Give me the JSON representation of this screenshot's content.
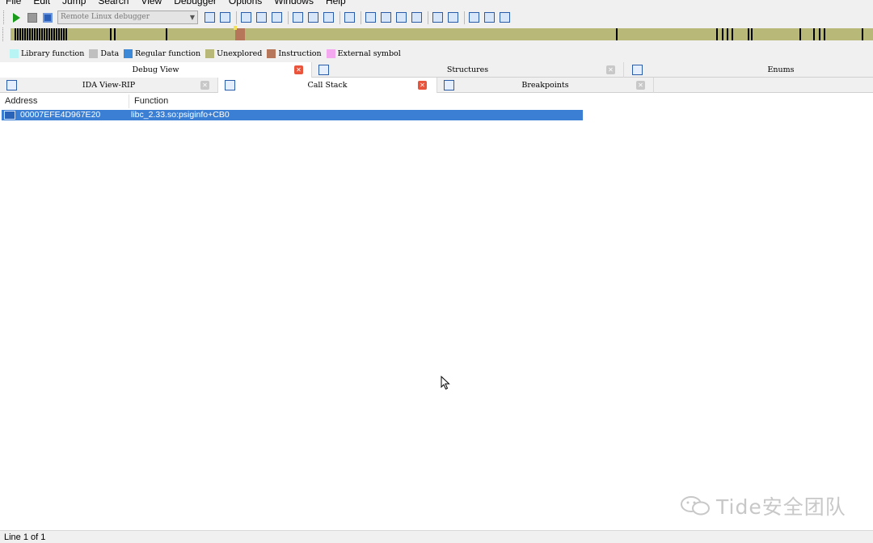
{
  "menu": [
    "File",
    "Edit",
    "Jump",
    "Search",
    "View",
    "Debugger",
    "Options",
    "Windows",
    "Help"
  ],
  "toolbar": {
    "debugger_select": "Remote Linux debugger",
    "icons": [
      "play-icon",
      "pause-icon",
      "stop-icon"
    ]
  },
  "legend": [
    {
      "label": "Library function",
      "color": "#b8f4f4"
    },
    {
      "label": "Data",
      "color": "#c0c0c0"
    },
    {
      "label": "Regular function",
      "color": "#3e88d8"
    },
    {
      "label": "Unexplored",
      "color": "#b8b878"
    },
    {
      "label": "Instruction",
      "color": "#b5765a"
    },
    {
      "label": "External symbol",
      "color": "#f4a8f0"
    }
  ],
  "tabs_top": [
    {
      "label": "Debug View",
      "active": true
    },
    {
      "label": "Structures",
      "active": false
    },
    {
      "label": "Enums",
      "active": false
    }
  ],
  "tabs_bottom": [
    {
      "label": "IDA View-RIP",
      "active": false
    },
    {
      "label": "Call Stack",
      "active": true
    },
    {
      "label": "Breakpoints",
      "active": false
    }
  ],
  "callstack": {
    "columns": [
      "Address",
      "Function"
    ],
    "rows": [
      {
        "address": "00007EFE4D967E20",
        "function": "libc_2.33.so:psiginfo+CB0",
        "selected": true
      }
    ]
  },
  "status": {
    "text": "Line 1 of 1"
  },
  "watermark": {
    "text": "Tide安全团队"
  },
  "colors": {
    "selection": "#3a7fd4",
    "navbar": "#b8b878",
    "close_active": "#e8553c"
  }
}
